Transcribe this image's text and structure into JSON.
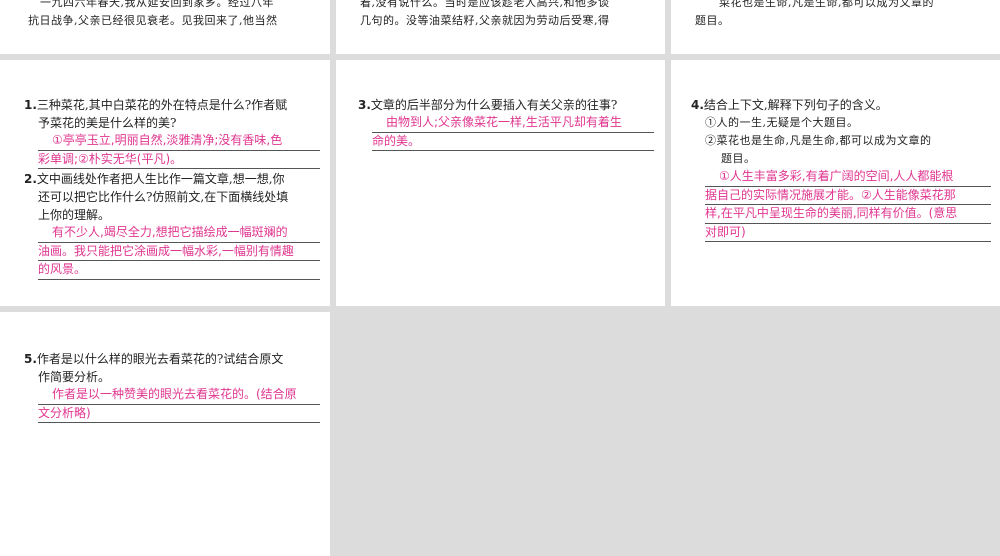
{
  "top": {
    "col1": {
      "line1": "一九四六年春天,我从延安回到家乡。经过八年",
      "line2": "抗日战争,父亲已经很见衰老。见我回来了,他当然"
    },
    "col2": {
      "line1": "着,没有说什么。当时是应该趁老人高兴,和他多谈",
      "line2": "几句的。没等油菜结籽,父亲就因为劳动后受寒,得"
    },
    "col3": {
      "line1": "菜花也是生命,凡是生命,都可以成为文章的",
      "line2": "题目。"
    }
  },
  "questions": {
    "q1": {
      "num": "1.",
      "text1": "三种菜花,其中白菜花的外在特点是什么?作者赋",
      "text2": "予菜花的美是什么样的美?",
      "answer1": "①亭亭玉立,明丽自然,淡雅清净;没有香味,色",
      "answer2": "彩单调;②朴实无华(平凡)。"
    },
    "q2": {
      "num": "2.",
      "text1": "文中画线处作者把人生比作一篇文章,想一想,你",
      "text2": "还可以把它比作什么?仿照前文,在下面横线处填",
      "text3": "上你的理解。",
      "answer1": "有不少人,竭尽全力,想把它描绘成一幅斑斓的",
      "answer2": "油画。我只能把它涂画成一幅水彩,一幅别有情趣",
      "answer3": "的风景。"
    },
    "q3": {
      "num": "3.",
      "text1": "文章的后半部分为什么要插入有关父亲的往事?",
      "answer1": "由物到人;父亲像菜花一样,生活平凡却有着生",
      "answer2": "命的美。"
    },
    "q4": {
      "num": "4.",
      "text1": "结合上下文,解释下列句子的含义。",
      "sub1": "①人的一生,无疑是个大题目。",
      "sub2a": "②菜花也是生命,凡是生命,都可以成为文章的",
      "sub2b": "题目。",
      "answer1": "①人生丰富多彩,有着广阔的空间,人人都能根",
      "answer2": "据自己的实际情况施展才能。②人生能像菜花那",
      "answer3": "样,在平凡中呈现生命的美丽,同样有价值。(意思",
      "answer4": "对即可)"
    },
    "q5": {
      "num": "5.",
      "text1": "作者是以什么样的眼光去看菜花的?试结合原文",
      "text2": "作简要分析。",
      "answer1": "作者是以一种赞美的眼光去看菜花的。(结合原",
      "answer2": "文分析略)"
    }
  }
}
